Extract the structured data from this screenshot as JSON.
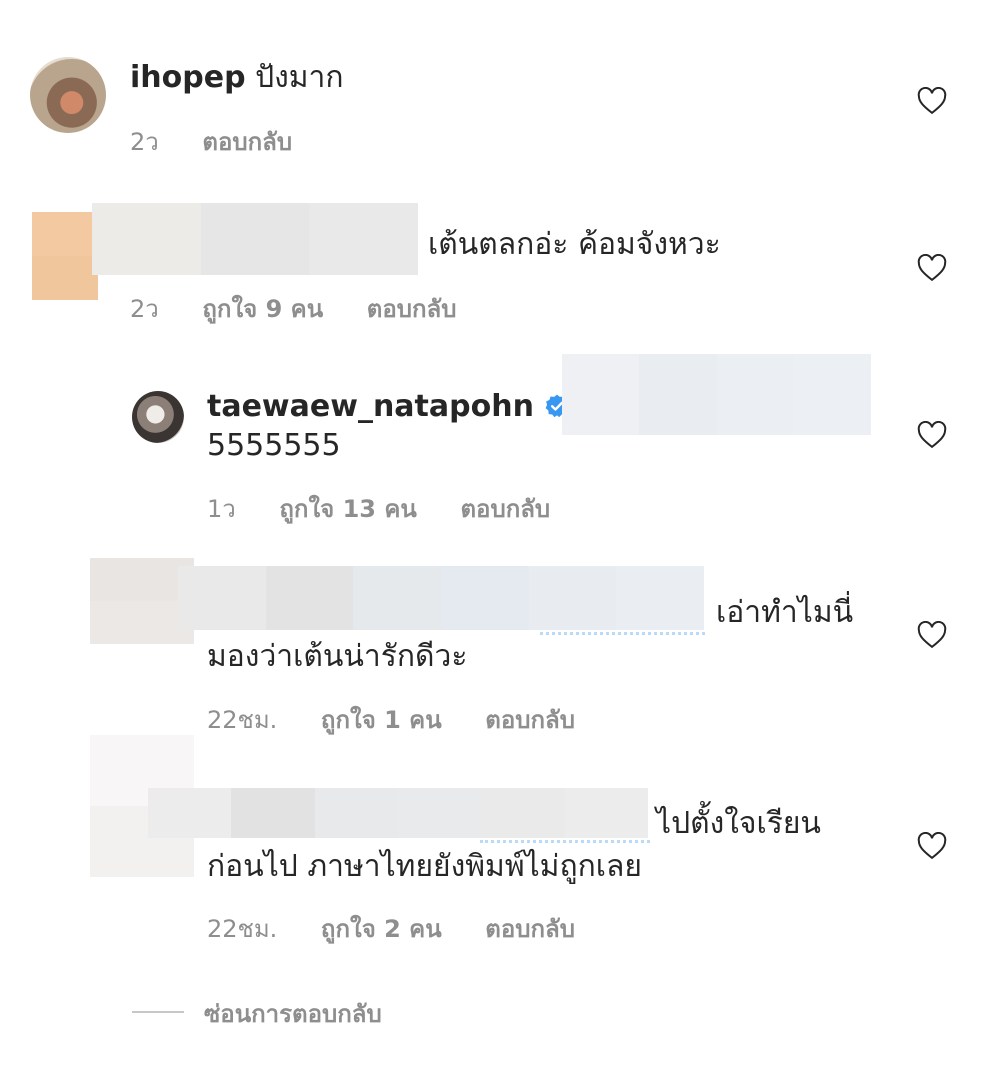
{
  "comments": [
    {
      "username": "ihopep",
      "text": "ปังมาก",
      "time": "2ว",
      "reply": "ตอบกลับ"
    },
    {
      "text": "เต้นตลกอ่ะ ค้อมจังหวะ",
      "time": "2ว",
      "likes": "ถูกใจ 9 คน",
      "reply": "ตอบกลับ"
    },
    {
      "username": "taewaew_natapohn",
      "text": "5555555",
      "time": "1ว",
      "likes": "ถูกใจ 13 คน",
      "reply": "ตอบกลับ"
    },
    {
      "text_line1": "เอ่าทำไมนี่",
      "text_line2": "มองว่าเต้นน่ารักดีวะ",
      "time": "22ชม.",
      "likes": "ถูกใจ 1 คน",
      "reply": "ตอบกลับ"
    },
    {
      "text_line1": "ไปตั้งใจเรียน",
      "text_line2": "ก่อนไป ภาษาไทยยังพิมพ์ไม่ถูกเลย",
      "time": "22ชม.",
      "likes": "ถูกใจ 2 คน",
      "reply": "ตอบกลับ"
    }
  ],
  "hide_replies": "ซ่อนการตอบกลับ",
  "colors": {
    "text": "#262626",
    "meta": "#8e8e8e",
    "verified": "#3897f0"
  }
}
